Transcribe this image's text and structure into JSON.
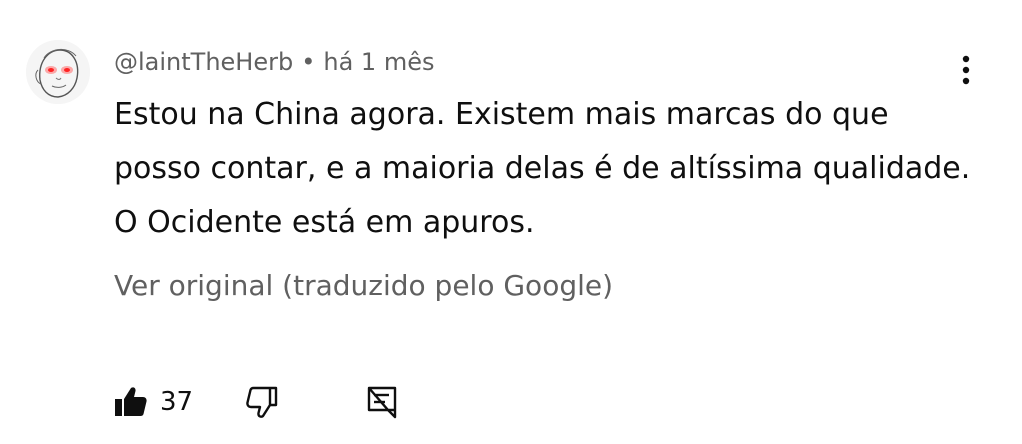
{
  "comment": {
    "author": "@laintTheHerb",
    "separator": "•",
    "timestamp": "há 1 mês",
    "text_lines": [
      "Estou na China agora. Existem mais marcas do que",
      "posso contar, e a maioria delas é de altíssima qualidade.",
      "O Ocidente está em apuros."
    ],
    "translate_link": "Ver original (traduzido pelo Google)",
    "like_count": "37"
  },
  "icons": {
    "avatar": "sketch-face-avatar",
    "more": "more-vertical-icon",
    "like": "thumbs-up-filled-icon",
    "dislike": "thumbs-down-outline-icon",
    "reply": "reply-comment-icon"
  },
  "colors": {
    "text": "#0f0f0f",
    "secondary": "#606060",
    "avatar_eyes": "#ff3b3b"
  }
}
